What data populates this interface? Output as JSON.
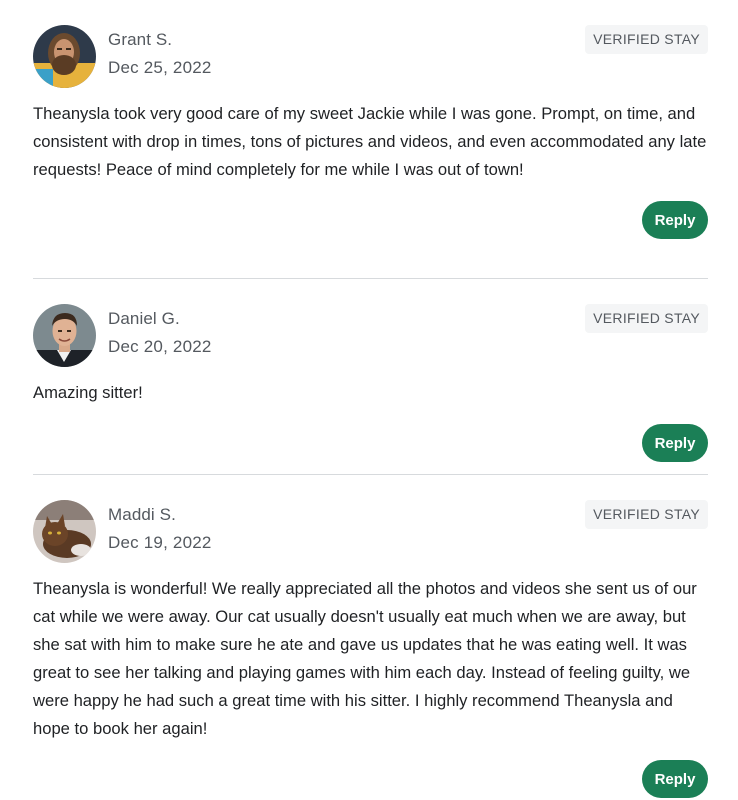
{
  "reviews": [
    {
      "name": "Grant S.",
      "date": "Dec 25, 2022",
      "badge": "VERIFIED STAY",
      "text": "Theanysla took very good care of my sweet Jackie while I was gone. Prompt, on time, and consistent with drop in times, tons of pictures and videos, and even accommodated any late requests! Peace of mind completely for me while I was out of town!",
      "reply_label": "Reply"
    },
    {
      "name": "Daniel G.",
      "date": "Dec 20, 2022",
      "badge": "VERIFIED STAY",
      "text": "Amazing sitter!",
      "reply_label": "Reply"
    },
    {
      "name": "Maddi S.",
      "date": "Dec 19, 2022",
      "badge": "VERIFIED STAY",
      "text": "Theanysla is wonderful! We really appreciated all the photos and videos she sent us of our cat while we were away. Our cat usually doesn't usually eat much when we are away, but she sat with him to make sure he ate and gave us updates that he was eating well. It was great to see her talking and playing games with him each day. Instead of feeling guilty, we were happy he had such a great time with his sitter. I highly recommend Theanysla and hope to book her again!",
      "reply_label": "Reply"
    }
  ],
  "colors": {
    "reply_button": "#1b7f56",
    "badge_bg": "#f4f5f6",
    "muted_text": "#54595f",
    "body_text": "#1f2124",
    "divider": "#d7dadd"
  }
}
